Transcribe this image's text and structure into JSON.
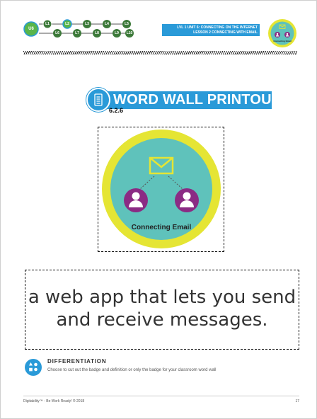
{
  "header": {
    "unit": "U6",
    "lessons_top": [
      "L1",
      "L2",
      "L3",
      "L4",
      "L5"
    ],
    "lessons_bottom": [
      "L6",
      "L7",
      "L8",
      "L9",
      "L10"
    ],
    "current_lesson": "L2",
    "course_line1": "LVL 1 UNIT 6: CONNECTING ON THE INTERNET",
    "course_line2": "LESSON 2 CONNECTING WITH EMAIL",
    "mini_badge_label": "Connecting Email"
  },
  "title": {
    "icon": "document-list-icon",
    "text": "WORD WALL PRINTOUT",
    "code": "6.2.6"
  },
  "badge": {
    "label": "Connecting Email",
    "icon": "envelope-icon",
    "people": [
      "user-icon",
      "user-icon"
    ]
  },
  "definition": {
    "text": "a web app that lets you send and receive messages."
  },
  "differentiation": {
    "icon": "shapes-icon",
    "title": "DIFFERENTIATION",
    "body": "Choose to cut out the badge and definition or only the badge for your classroom word wall"
  },
  "footer": {
    "left": "Digitability™ - Be Work Ready! ® 2018",
    "page": "17"
  },
  "colors": {
    "accent_blue": "#2a9ad8",
    "green": "#59b54a",
    "dark_green": "#3d7a3a",
    "teal": "#5fc2bb",
    "yellow": "#e5e534",
    "purple": "#8b2b84"
  }
}
